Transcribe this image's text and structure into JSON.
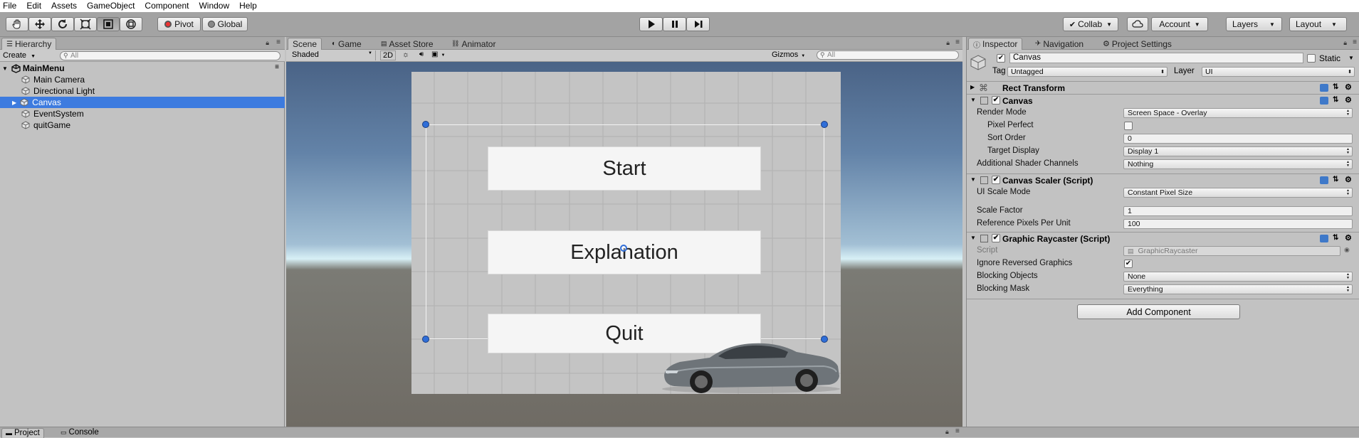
{
  "menu": [
    "File",
    "Edit",
    "Assets",
    "GameObject",
    "Component",
    "Window",
    "Help"
  ],
  "toolbar": {
    "pivot_label": "Pivot",
    "global_label": "Global",
    "collab_label": "Collab",
    "account_label": "Account",
    "layers_label": "Layers",
    "layout_label": "Layout"
  },
  "hierarchy": {
    "tab_label": "Hierarchy",
    "create_label": "Create",
    "search_placeholder": "All",
    "scene_name": "MainMenu",
    "items": [
      {
        "label": "Main Camera",
        "selected": false
      },
      {
        "label": "Directional Light",
        "selected": false
      },
      {
        "label": "Canvas",
        "selected": true
      },
      {
        "label": "EventSystem",
        "selected": false
      },
      {
        "label": "quitGame",
        "selected": false
      }
    ]
  },
  "scene": {
    "tabs": [
      "Scene",
      "Game",
      "Asset Store",
      "Animator"
    ],
    "shading_mode": "Shaded",
    "mode_2d": "2D",
    "gizmos_label": "Gizmos",
    "search_placeholder": "All",
    "buttons": [
      "Start",
      "Explanation",
      "Quit"
    ]
  },
  "inspector": {
    "tabs": [
      "Inspector",
      "Navigation",
      "Project Settings"
    ],
    "object_name": "Canvas",
    "static_label": "Static",
    "tag_label": "Tag",
    "tag_value": "Untagged",
    "layer_label": "Layer",
    "layer_value": "UI",
    "rect_transform": "Rect Transform",
    "canvas": {
      "title": "Canvas",
      "render_mode_label": "Render Mode",
      "render_mode_value": "Screen Space - Overlay",
      "pixel_perfect_label": "Pixel Perfect",
      "sort_order_label": "Sort Order",
      "sort_order_value": "0",
      "target_display_label": "Target Display",
      "target_display_value": "Display 1",
      "shader_channels_label": "Additional Shader Channels",
      "shader_channels_value": "Nothing"
    },
    "scaler": {
      "title": "Canvas Scaler (Script)",
      "ui_scale_mode_label": "UI Scale Mode",
      "ui_scale_mode_value": "Constant Pixel Size",
      "scale_factor_label": "Scale Factor",
      "scale_factor_value": "1",
      "ref_pixels_label": "Reference Pixels Per Unit",
      "ref_pixels_value": "100"
    },
    "raycaster": {
      "title": "Graphic Raycaster (Script)",
      "script_label": "Script",
      "script_value": "GraphicRaycaster",
      "ignore_reversed_label": "Ignore Reversed Graphics",
      "blocking_objects_label": "Blocking Objects",
      "blocking_objects_value": "None",
      "blocking_mask_label": "Blocking Mask",
      "blocking_mask_value": "Everything"
    },
    "add_component_label": "Add Component"
  },
  "bottom": {
    "tabs": [
      "Project",
      "Console"
    ]
  },
  "colors": {
    "selection": "#3d7bdf",
    "panel_bg": "#c2c2c2",
    "toolbar_bg": "#a3a3a3"
  }
}
